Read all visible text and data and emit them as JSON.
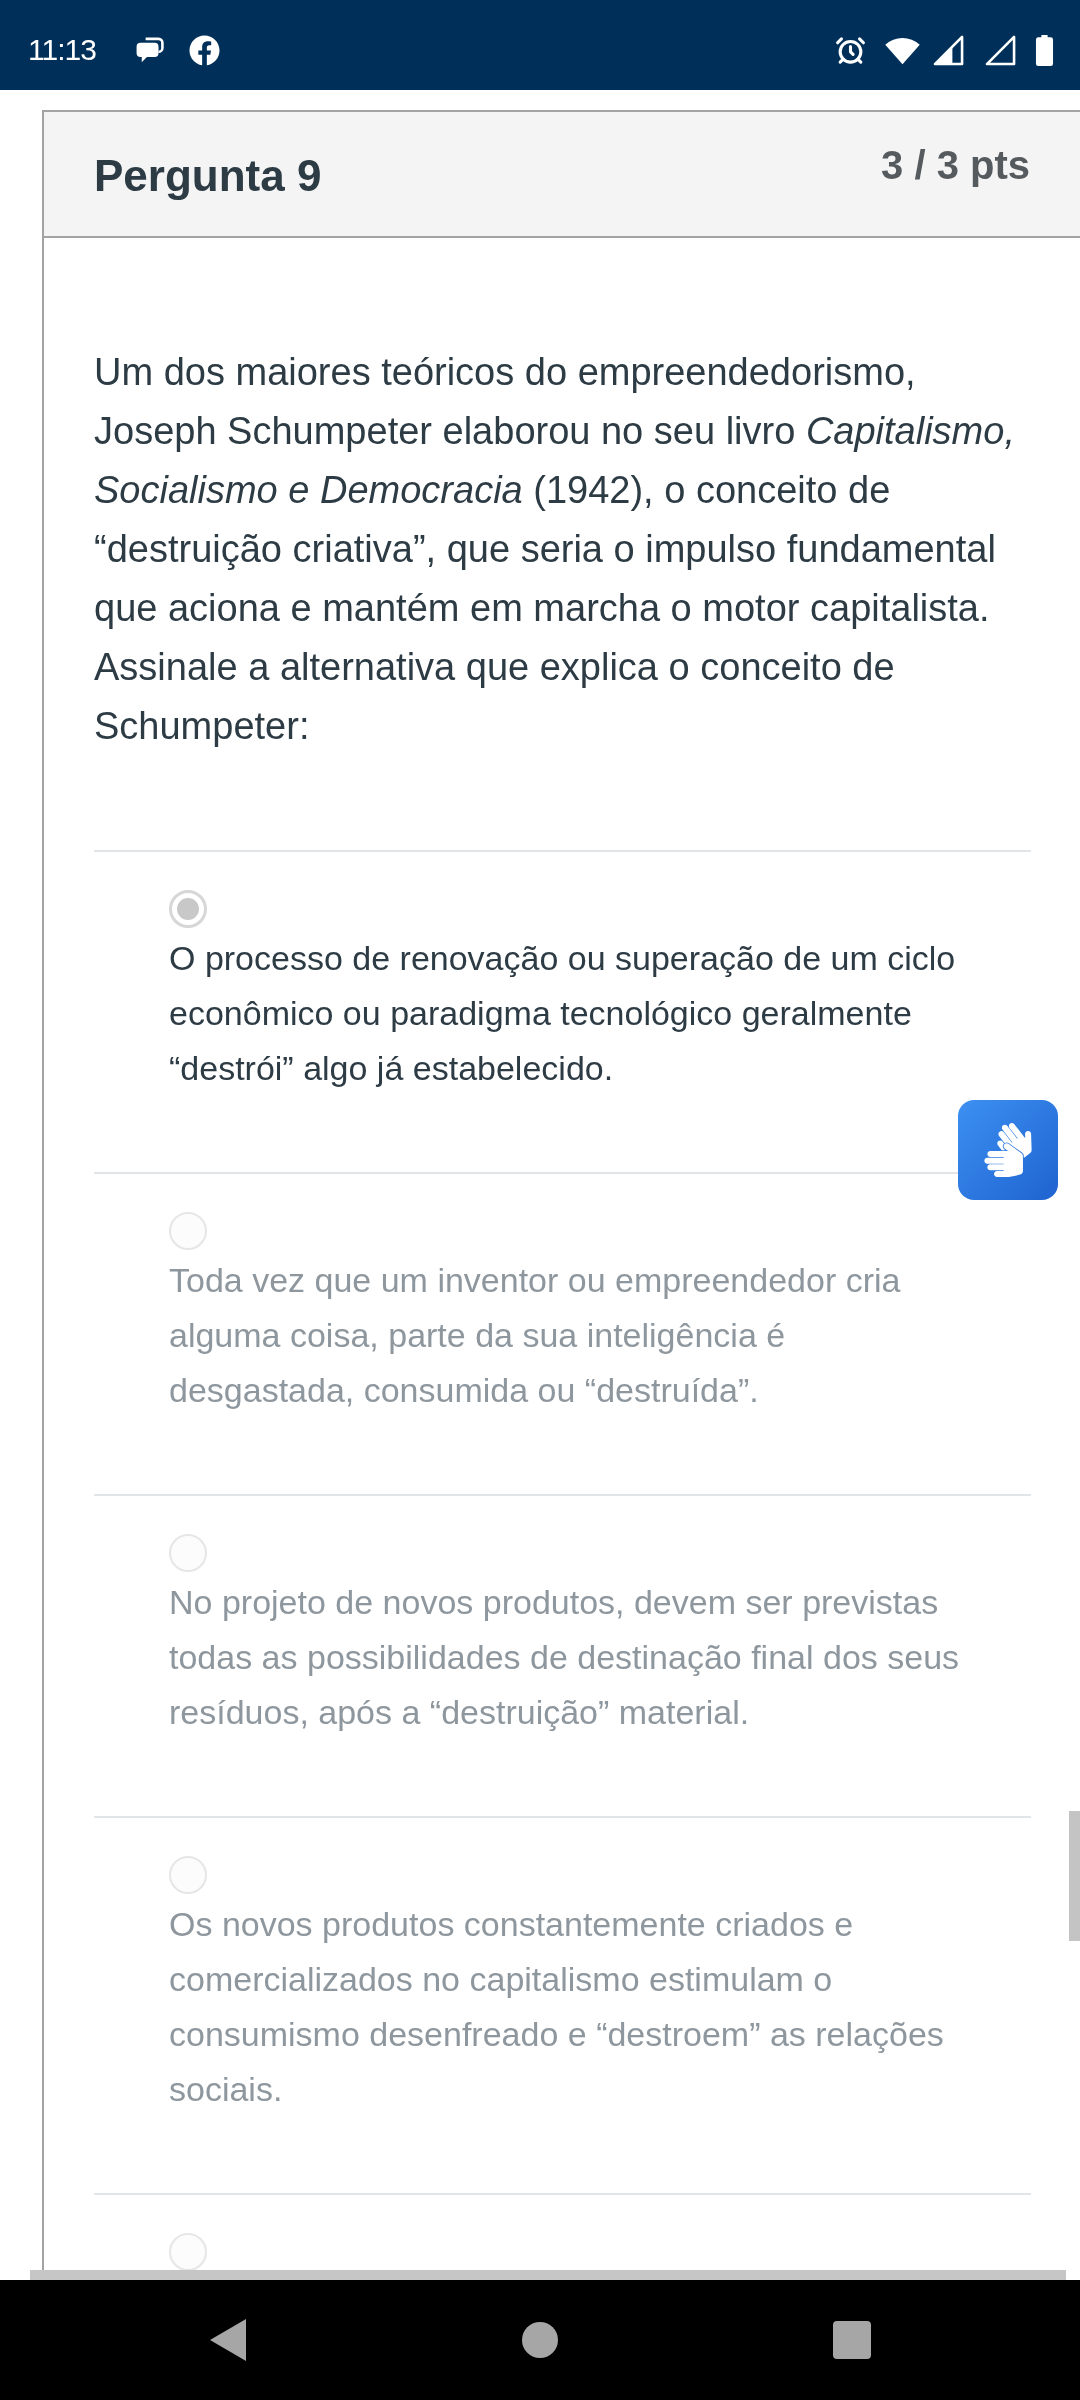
{
  "status_bar": {
    "time": "11:13"
  },
  "question": {
    "title": "Pergunta 9",
    "points": "3 / 3 pts",
    "text": "Um dos maiores teóricos do empreendedorismo, Joseph Schumpeter elaborou no seu livro *Capitalismo, Socialismo e Democracia* (1942), o conceito de “destruição criativa”, que seria o impulso fundamental que aciona e mantém em marcha o motor capitalista. Assinale a alternativa que explica o conceito de Schumpeter:"
  },
  "answers": [
    {
      "text": "O processo de renovação ou superação de um ciclo econômico ou paradigma tecnológico geralmente “destrói” algo já estabelecido.",
      "selected": true
    },
    {
      "text": "Toda vez que um inventor ou empreendedor cria alguma coisa, parte da sua inteligência é desgastada, consumida ou “destruída”.",
      "selected": false
    },
    {
      "text": "No projeto de novos produtos, devem ser previstas todas as possibilidades de destinação final dos seus resíduos, após a “destruição” material.",
      "selected": false
    },
    {
      "text": "Os novos produtos constantemente criados e comercializados no capitalismo estimulam o consumismo desenfreado e “destroem” as relações sociais.",
      "selected": false
    },
    {
      "selected": false
    }
  ]
}
